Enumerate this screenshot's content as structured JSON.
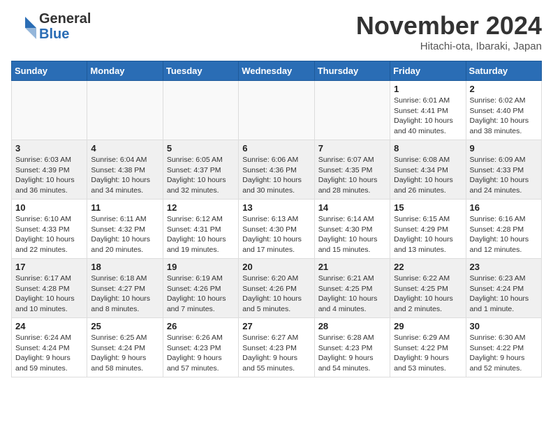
{
  "header": {
    "logo_general": "General",
    "logo_blue": "Blue",
    "title": "November 2024",
    "location": "Hitachi-ota, Ibaraki, Japan"
  },
  "weekdays": [
    "Sunday",
    "Monday",
    "Tuesday",
    "Wednesday",
    "Thursday",
    "Friday",
    "Saturday"
  ],
  "weeks": [
    [
      {
        "day": "",
        "info": ""
      },
      {
        "day": "",
        "info": ""
      },
      {
        "day": "",
        "info": ""
      },
      {
        "day": "",
        "info": ""
      },
      {
        "day": "",
        "info": ""
      },
      {
        "day": "1",
        "info": "Sunrise: 6:01 AM\nSunset: 4:41 PM\nDaylight: 10 hours and 40 minutes."
      },
      {
        "day": "2",
        "info": "Sunrise: 6:02 AM\nSunset: 4:40 PM\nDaylight: 10 hours and 38 minutes."
      }
    ],
    [
      {
        "day": "3",
        "info": "Sunrise: 6:03 AM\nSunset: 4:39 PM\nDaylight: 10 hours and 36 minutes."
      },
      {
        "day": "4",
        "info": "Sunrise: 6:04 AM\nSunset: 4:38 PM\nDaylight: 10 hours and 34 minutes."
      },
      {
        "day": "5",
        "info": "Sunrise: 6:05 AM\nSunset: 4:37 PM\nDaylight: 10 hours and 32 minutes."
      },
      {
        "day": "6",
        "info": "Sunrise: 6:06 AM\nSunset: 4:36 PM\nDaylight: 10 hours and 30 minutes."
      },
      {
        "day": "7",
        "info": "Sunrise: 6:07 AM\nSunset: 4:35 PM\nDaylight: 10 hours and 28 minutes."
      },
      {
        "day": "8",
        "info": "Sunrise: 6:08 AM\nSunset: 4:34 PM\nDaylight: 10 hours and 26 minutes."
      },
      {
        "day": "9",
        "info": "Sunrise: 6:09 AM\nSunset: 4:33 PM\nDaylight: 10 hours and 24 minutes."
      }
    ],
    [
      {
        "day": "10",
        "info": "Sunrise: 6:10 AM\nSunset: 4:33 PM\nDaylight: 10 hours and 22 minutes."
      },
      {
        "day": "11",
        "info": "Sunrise: 6:11 AM\nSunset: 4:32 PM\nDaylight: 10 hours and 20 minutes."
      },
      {
        "day": "12",
        "info": "Sunrise: 6:12 AM\nSunset: 4:31 PM\nDaylight: 10 hours and 19 minutes."
      },
      {
        "day": "13",
        "info": "Sunrise: 6:13 AM\nSunset: 4:30 PM\nDaylight: 10 hours and 17 minutes."
      },
      {
        "day": "14",
        "info": "Sunrise: 6:14 AM\nSunset: 4:30 PM\nDaylight: 10 hours and 15 minutes."
      },
      {
        "day": "15",
        "info": "Sunrise: 6:15 AM\nSunset: 4:29 PM\nDaylight: 10 hours and 13 minutes."
      },
      {
        "day": "16",
        "info": "Sunrise: 6:16 AM\nSunset: 4:28 PM\nDaylight: 10 hours and 12 minutes."
      }
    ],
    [
      {
        "day": "17",
        "info": "Sunrise: 6:17 AM\nSunset: 4:28 PM\nDaylight: 10 hours and 10 minutes."
      },
      {
        "day": "18",
        "info": "Sunrise: 6:18 AM\nSunset: 4:27 PM\nDaylight: 10 hours and 8 minutes."
      },
      {
        "day": "19",
        "info": "Sunrise: 6:19 AM\nSunset: 4:26 PM\nDaylight: 10 hours and 7 minutes."
      },
      {
        "day": "20",
        "info": "Sunrise: 6:20 AM\nSunset: 4:26 PM\nDaylight: 10 hours and 5 minutes."
      },
      {
        "day": "21",
        "info": "Sunrise: 6:21 AM\nSunset: 4:25 PM\nDaylight: 10 hours and 4 minutes."
      },
      {
        "day": "22",
        "info": "Sunrise: 6:22 AM\nSunset: 4:25 PM\nDaylight: 10 hours and 2 minutes."
      },
      {
        "day": "23",
        "info": "Sunrise: 6:23 AM\nSunset: 4:24 PM\nDaylight: 10 hours and 1 minute."
      }
    ],
    [
      {
        "day": "24",
        "info": "Sunrise: 6:24 AM\nSunset: 4:24 PM\nDaylight: 9 hours and 59 minutes."
      },
      {
        "day": "25",
        "info": "Sunrise: 6:25 AM\nSunset: 4:24 PM\nDaylight: 9 hours and 58 minutes."
      },
      {
        "day": "26",
        "info": "Sunrise: 6:26 AM\nSunset: 4:23 PM\nDaylight: 9 hours and 57 minutes."
      },
      {
        "day": "27",
        "info": "Sunrise: 6:27 AM\nSunset: 4:23 PM\nDaylight: 9 hours and 55 minutes."
      },
      {
        "day": "28",
        "info": "Sunrise: 6:28 AM\nSunset: 4:23 PM\nDaylight: 9 hours and 54 minutes."
      },
      {
        "day": "29",
        "info": "Sunrise: 6:29 AM\nSunset: 4:22 PM\nDaylight: 9 hours and 53 minutes."
      },
      {
        "day": "30",
        "info": "Sunrise: 6:30 AM\nSunset: 4:22 PM\nDaylight: 9 hours and 52 minutes."
      }
    ]
  ]
}
